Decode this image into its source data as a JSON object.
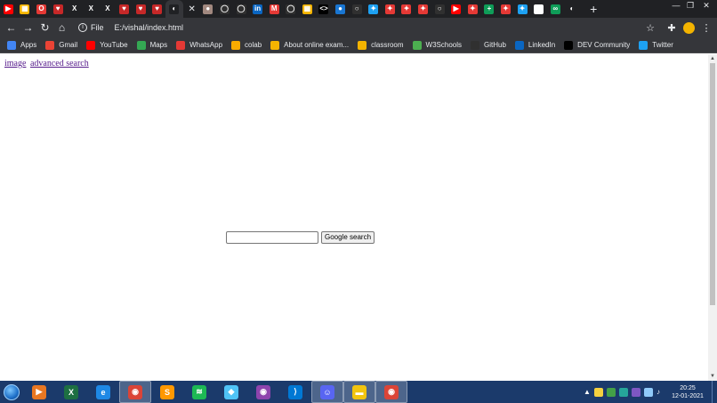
{
  "browser": {
    "tabs": [
      {
        "icon": "youtube-icon",
        "color": "#ff0000",
        "glyph": "▶"
      },
      {
        "icon": "grid-icon",
        "color": "#f4b400",
        "glyph": "▦"
      },
      {
        "icon": "opera-icon",
        "color": "#e53935",
        "glyph": "O"
      },
      {
        "icon": "shield-icon",
        "color": "#c62828",
        "glyph": "♥"
      },
      {
        "icon": "x-icon",
        "color": "#202124",
        "glyph": "X"
      },
      {
        "icon": "x-icon",
        "color": "#202124",
        "glyph": "X"
      },
      {
        "icon": "x-icon",
        "color": "#202124",
        "glyph": "X"
      },
      {
        "icon": "shield-icon",
        "color": "#c62828",
        "glyph": "♥"
      },
      {
        "icon": "shield-icon",
        "color": "#c62828",
        "glyph": "♥"
      },
      {
        "icon": "shield-icon",
        "color": "#c62828",
        "glyph": "♥"
      },
      {
        "icon": "globe-icon",
        "color": "#202124",
        "glyph": "◐",
        "active": true
      },
      {
        "icon": "user-icon",
        "color": "#a1887f",
        "glyph": "●"
      },
      {
        "icon": "github-icon",
        "color": "#303030",
        "glyph": "◯"
      },
      {
        "icon": "github-icon",
        "color": "#303030",
        "glyph": "◯"
      },
      {
        "icon": "linkedin-icon",
        "color": "#0a66c2",
        "glyph": "in"
      },
      {
        "icon": "m-icon",
        "color": "#e53935",
        "glyph": "M"
      },
      {
        "icon": "github-icon",
        "color": "#303030",
        "glyph": "◯"
      },
      {
        "icon": "grid-icon",
        "color": "#f4b400",
        "glyph": "▦"
      },
      {
        "icon": "code-icon",
        "color": "#000000",
        "glyph": "<>"
      },
      {
        "icon": "leaf-icon",
        "color": "#1976d2",
        "glyph": "●"
      },
      {
        "icon": "circle-icon",
        "color": "#303030",
        "glyph": "○"
      },
      {
        "icon": "twitter-icon",
        "color": "#1da1f2",
        "glyph": "✦"
      },
      {
        "icon": "sparkle-icon",
        "color": "#e53935",
        "glyph": "✦"
      },
      {
        "icon": "sparkle-icon",
        "color": "#e53935",
        "glyph": "✦"
      },
      {
        "icon": "sparkle-icon",
        "color": "#e53935",
        "glyph": "✦"
      },
      {
        "icon": "circle-icon",
        "color": "#303030",
        "glyph": "○"
      },
      {
        "icon": "youtube-icon",
        "color": "#ff0000",
        "glyph": "▶"
      },
      {
        "icon": "sparkle-icon",
        "color": "#e53935",
        "glyph": "✦"
      },
      {
        "icon": "plus-square-icon",
        "color": "#0f9d58",
        "glyph": "+"
      },
      {
        "icon": "sparkle-icon",
        "color": "#e53935",
        "glyph": "✦"
      },
      {
        "icon": "twitter-icon",
        "color": "#1da1f2",
        "glyph": "✦"
      },
      {
        "icon": "google-icon",
        "color": "#ffffff",
        "glyph": "G"
      },
      {
        "icon": "infinity-icon",
        "color": "#0f9d58",
        "glyph": "∞"
      },
      {
        "icon": "globe-icon",
        "color": "#202124",
        "glyph": "◐"
      }
    ],
    "address": {
      "scheme": "File",
      "url": "E:/vishal/index.html"
    }
  },
  "bookmarks": [
    {
      "label": "Apps",
      "icon": "apps-grid-icon",
      "color": "#4285f4"
    },
    {
      "label": "Gmail",
      "icon": "gmail-icon",
      "color": "#ea4335"
    },
    {
      "label": "YouTube",
      "icon": "youtube-icon",
      "color": "#ff0000"
    },
    {
      "label": "Maps",
      "icon": "maps-icon",
      "color": "#34a853"
    },
    {
      "label": "WhatsApp",
      "icon": "whatsapp-icon",
      "color": "#e53935"
    },
    {
      "label": "colab",
      "icon": "colab-icon",
      "color": "#f9ab00"
    },
    {
      "label": "About online exam...",
      "icon": "grid-icon",
      "color": "#f4b400"
    },
    {
      "label": "classroom",
      "icon": "classroom-icon",
      "color": "#f4b400"
    },
    {
      "label": "W3Schools",
      "icon": "w3schools-icon",
      "color": "#4caf50"
    },
    {
      "label": "GitHub",
      "icon": "github-icon",
      "color": "#303030"
    },
    {
      "label": "LinkedIn",
      "icon": "linkedin-icon",
      "color": "#0a66c2"
    },
    {
      "label": "DEV Community",
      "icon": "dev-icon",
      "color": "#000000"
    },
    {
      "label": "Twitter",
      "icon": "twitter-icon",
      "color": "#1da1f2"
    }
  ],
  "page": {
    "links": [
      "image",
      "advanced search"
    ],
    "search": {
      "value": "",
      "placeholder": ""
    },
    "search_button_label": "Google search"
  },
  "taskbar": {
    "apps": [
      {
        "icon": "media-player-icon",
        "color": "#e87722",
        "glyph": "▶"
      },
      {
        "icon": "excel-icon",
        "color": "#1d6f42",
        "glyph": "X"
      },
      {
        "icon": "internet-explorer-icon",
        "color": "#1e88e5",
        "glyph": "e"
      },
      {
        "icon": "chrome-icon",
        "color": "#db4437",
        "glyph": "◉",
        "active": true
      },
      {
        "icon": "sublime-text-icon",
        "color": "#ff9800",
        "glyph": "S"
      },
      {
        "icon": "spotify-icon",
        "color": "#1db954",
        "glyph": "≋"
      },
      {
        "icon": "git-kraken-icon",
        "color": "#4fc3f7",
        "glyph": "◆"
      },
      {
        "icon": "github-desktop-icon",
        "color": "#8e44ad",
        "glyph": "◉"
      },
      {
        "icon": "vscode-icon",
        "color": "#0078d4",
        "glyph": "⟩"
      },
      {
        "icon": "discord-icon",
        "color": "#5865f2",
        "glyph": "☺",
        "active": true
      },
      {
        "icon": "file-explorer-icon",
        "color": "#f1c40f",
        "glyph": "▬",
        "active": true
      },
      {
        "icon": "chrome-icon",
        "color": "#db4437",
        "glyph": "◉",
        "active": true
      }
    ],
    "clock": {
      "time": "20:25",
      "date": "12-01-2021"
    }
  }
}
